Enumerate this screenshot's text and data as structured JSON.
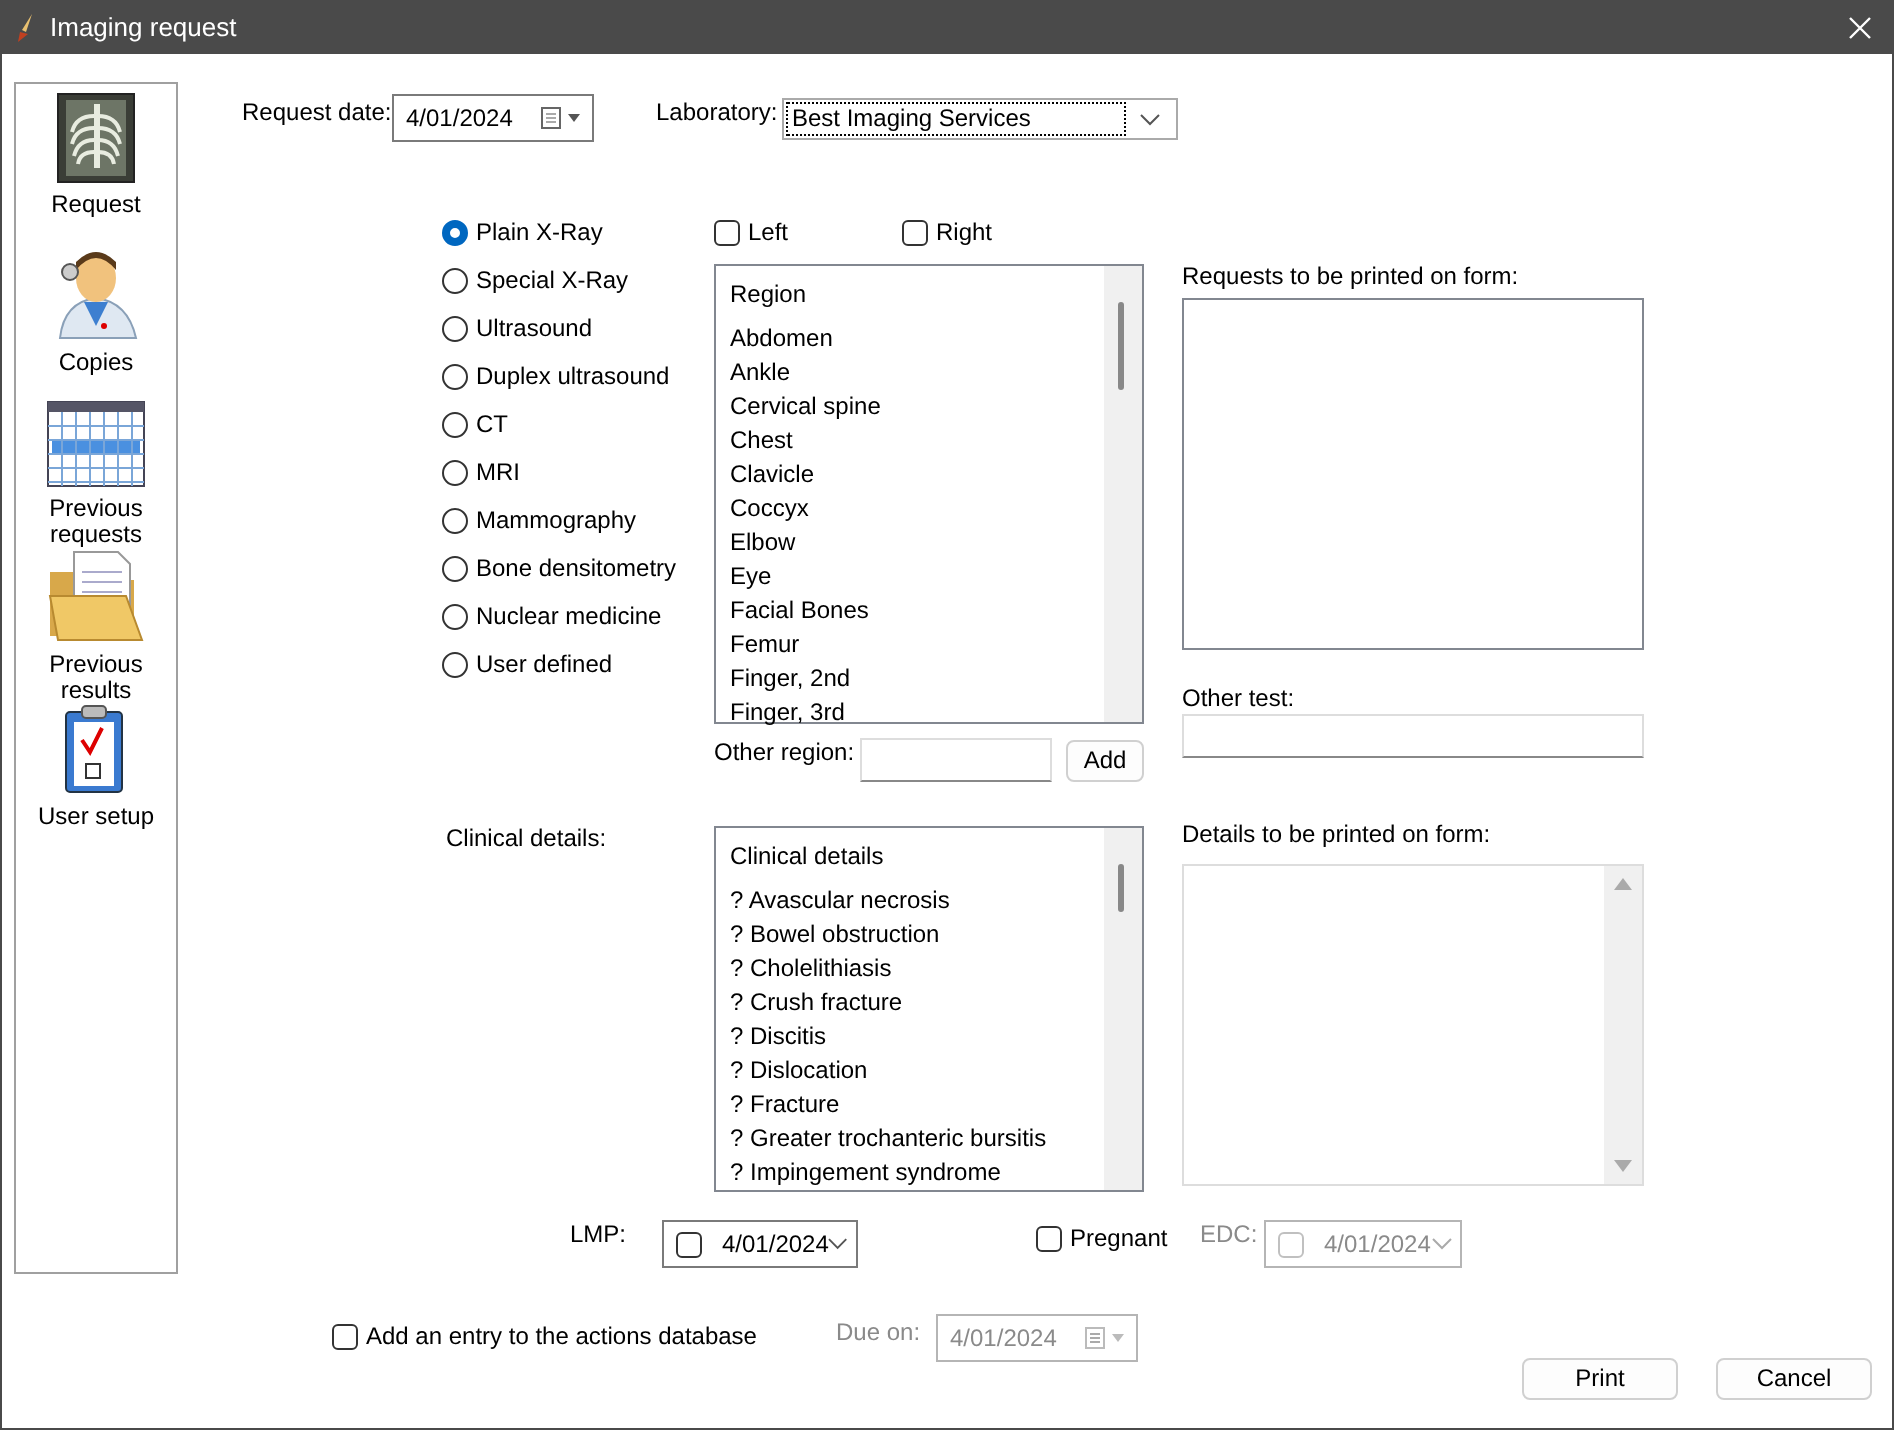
{
  "window": {
    "title": "Imaging request"
  },
  "sidebar": {
    "items": [
      {
        "label": "Request",
        "kind": "xray"
      },
      {
        "label": "Copies",
        "kind": "doctor"
      },
      {
        "label": "Previous requests",
        "kind": "calendar"
      },
      {
        "label": "Previous results",
        "kind": "folder"
      },
      {
        "label": "User setup",
        "kind": "clipboard"
      }
    ]
  },
  "request_date": {
    "label": "Request date:",
    "value": "4/01/2024",
    "kind": "calendar",
    "disabled": false
  },
  "laboratory": {
    "label": "Laboratory:",
    "value": "Best Imaging Services"
  },
  "modalities": [
    {
      "label": "Plain X-Ray",
      "selected": true
    },
    {
      "label": "Special X-Ray",
      "selected": false
    },
    {
      "label": "Ultrasound",
      "selected": false
    },
    {
      "label": "Duplex ultrasound",
      "selected": false
    },
    {
      "label": "CT",
      "selected": false
    },
    {
      "label": "MRI",
      "selected": false
    },
    {
      "label": "Mammography",
      "selected": false
    },
    {
      "label": "Bone densitometry",
      "selected": false
    },
    {
      "label": "Nuclear medicine",
      "selected": false
    },
    {
      "label": "User defined",
      "selected": false
    }
  ],
  "sides": [
    {
      "label": "Left",
      "checked": false
    },
    {
      "label": "Right",
      "checked": false
    }
  ],
  "region_list": {
    "header": "Region",
    "items": [
      "Abdomen",
      "Ankle",
      "Cervical spine",
      "Chest",
      "Clavicle",
      "Coccyx",
      "Elbow",
      "Eye",
      "Facial Bones",
      "Femur",
      "Finger, 2nd",
      "Finger, 3rd"
    ]
  },
  "other_region": {
    "label": "Other region:",
    "button": "Add"
  },
  "requests_box": {
    "label": "Requests to be printed on form:"
  },
  "other_test": {
    "label": "Other test:"
  },
  "clinical": {
    "label": "Clinical details:",
    "header": "Clinical details",
    "items": [
      "? Avascular necrosis",
      "? Bowel obstruction",
      "? Cholelithiasis",
      "? Crush fracture",
      "? Discitis",
      "? Dislocation",
      "? Fracture",
      "? Greater trochanteric bursitis",
      "? Impingement syndrome"
    ]
  },
  "details_box": {
    "label": "Details to be printed on form:"
  },
  "lmp": {
    "label": "LMP:",
    "value": "4/01/2024",
    "kind": "checkbox",
    "checked": false,
    "disabled": false
  },
  "pregnant": {
    "label": "Pregnant",
    "checked": false
  },
  "edc": {
    "label": "EDC:",
    "value": "4/01/2024",
    "kind": "checkbox",
    "checked": false,
    "disabled": true
  },
  "actions": {
    "label": "Add an entry to the actions database",
    "checked": false
  },
  "due_on": {
    "label": "Due on:",
    "value": "4/01/2024",
    "kind": "calendar",
    "disabled": true
  },
  "buttons": [
    {
      "label": "Print"
    },
    {
      "label": "Cancel"
    }
  ]
}
